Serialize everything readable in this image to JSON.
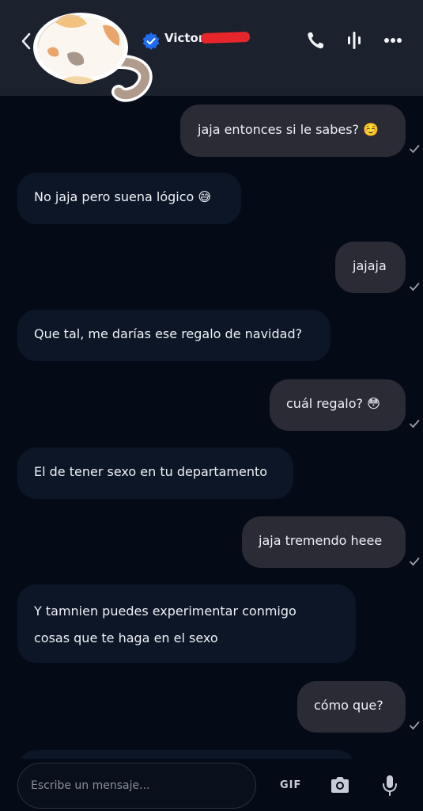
{
  "header": {
    "contact_name": "Victor",
    "verified_color": "#1d6cf2",
    "icons": [
      "back-arrow-icon",
      "verified-badge-icon",
      "phone-icon",
      "voice-bars-icon",
      "more-dots-icon"
    ]
  },
  "messages": [
    {
      "direction": "out",
      "text": "jaja entonces si le sabes? ☺️"
    },
    {
      "direction": "in",
      "text": "No jaja pero suena lógico 😅"
    },
    {
      "direction": "out",
      "text": "jajaja"
    },
    {
      "direction": "in",
      "text": "Que tal, me darías ese regalo de navidad?"
    },
    {
      "direction": "out",
      "text": "cuál regalo? 😳"
    },
    {
      "direction": "in",
      "text": "El de tener sexo en tu departamento"
    },
    {
      "direction": "out",
      "text": "jaja tremendo heee"
    },
    {
      "direction": "in",
      "line1": "Y tamnien puedes experimentar conmigo",
      "line2": "cosas que te haga en el sexo"
    },
    {
      "direction": "out",
      "text": "cómo que?"
    }
  ],
  "composer": {
    "placeholder": "Escribe un mensaje...",
    "gif_label": "GIF"
  }
}
